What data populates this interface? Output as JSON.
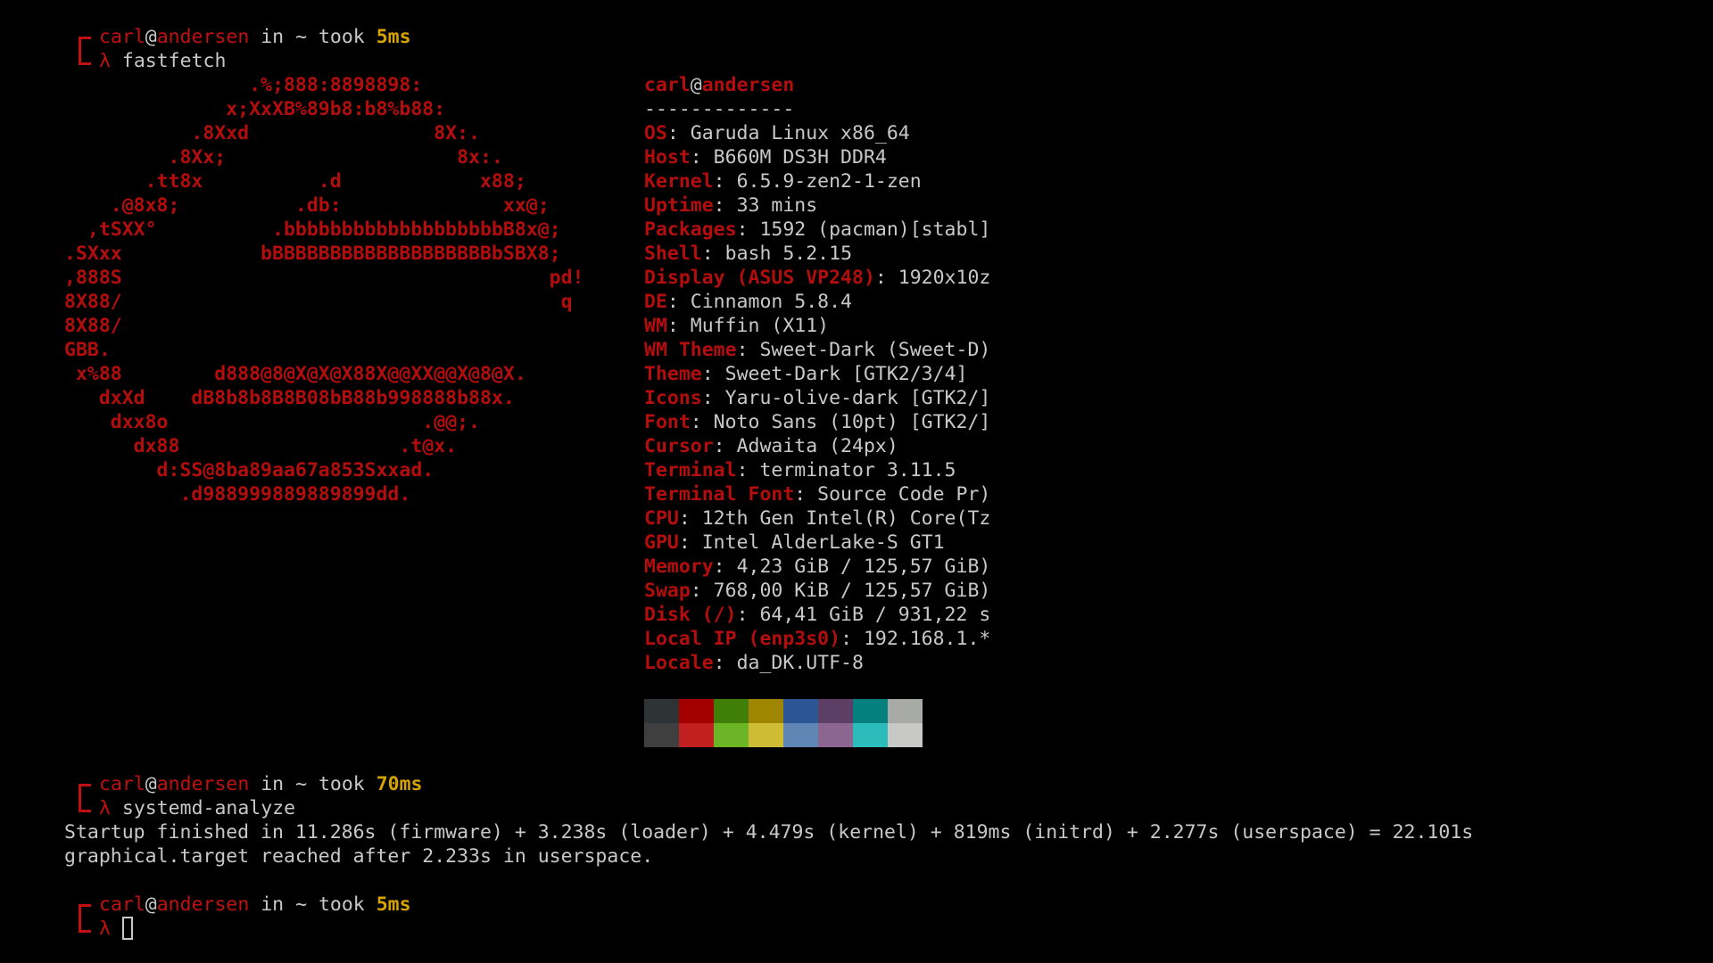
{
  "prompts": [
    {
      "user": "carl",
      "at": "@",
      "host": "andersen",
      "in": " in ~ took ",
      "time": "5ms",
      "symbol": "λ",
      "command": "fastfetch"
    },
    {
      "user": "carl",
      "at": "@",
      "host": "andersen",
      "in": " in ~ took ",
      "time": "70ms",
      "symbol": "λ",
      "command": "systemd-analyze"
    },
    {
      "user": "carl",
      "at": "@",
      "host": "andersen",
      "in": " in ~ took ",
      "time": "5ms",
      "symbol": "λ",
      "command": ""
    }
  ],
  "ascii_logo": "                .%;888:8898898:\n              x;XxXB%89b8:b8%b88:\n           .8Xxd                8X:.\n         .8Xx;                    8x:.\n       .tt8x          .d            x88;\n    .@8x8;          .db:              xx@;\n  ,tSXX°          .bbbbbbbbbbbbbbbbbbbB8x@;\n.SXxx            bBBBBBBBBBBBBBBBBBBBbSBX8;\n,888S                                     pd!\n8X88/                                      q\n8X88/\nGBB.\n x%88        d888@8@X@X@X88X@@XX@@X@8@X.\n   dxXd    dB8b8b8B8B08bB88b998888b88x.\n    dxx8o                      .@@;.\n      dx88                   .t@x.\n        d:SS@8ba89aa67a853Sxxad.\n          .d988999889889899dd.",
  "fastfetch": {
    "title_user": "carl",
    "title_at": "@",
    "title_host": "andersen",
    "separator": "-------------",
    "info": [
      {
        "key": "OS",
        "value": "Garuda Linux x86_64"
      },
      {
        "key": "Host",
        "value": "B660M DS3H DDR4"
      },
      {
        "key": "Kernel",
        "value": "6.5.9-zen2-1-zen"
      },
      {
        "key": "Uptime",
        "value": "33 mins"
      },
      {
        "key": "Packages",
        "value": "1592 (pacman)[stabl]"
      },
      {
        "key": "Shell",
        "value": "bash 5.2.15"
      },
      {
        "key": "Display (ASUS VP248)",
        "value": "1920x10z"
      },
      {
        "key": "DE",
        "value": "Cinnamon 5.8.4"
      },
      {
        "key": "WM",
        "value": "Muffin (X11)"
      },
      {
        "key": "WM Theme",
        "value": "Sweet-Dark (Sweet-D)"
      },
      {
        "key": "Theme",
        "value": "Sweet-Dark [GTK2/3/4]"
      },
      {
        "key": "Icons",
        "value": "Yaru-olive-dark [GTK2/]"
      },
      {
        "key": "Font",
        "value": "Noto Sans (10pt) [GTK2/]"
      },
      {
        "key": "Cursor",
        "value": "Adwaita (24px)"
      },
      {
        "key": "Terminal",
        "value": "terminator 3.11.5"
      },
      {
        "key": "Terminal Font",
        "value": "Source Code Pr)"
      },
      {
        "key": "CPU",
        "value": "12th Gen Intel(R) Core(Tz"
      },
      {
        "key": "GPU",
        "value": "Intel AlderLake-S GT1"
      },
      {
        "key": "Memory",
        "value": "4,23 GiB / 125,57 GiB)"
      },
      {
        "key": "Swap",
        "value": "768,00 KiB / 125,57 GiB)"
      },
      {
        "key": "Disk (/)",
        "value": "64,41 GiB / 931,22 s"
      },
      {
        "key": "Local IP (enp3s0)",
        "value": "192.168.1.*"
      },
      {
        "key": "Locale",
        "value": "da_DK.UTF-8"
      }
    ],
    "palette_top": [
      "#2e3436",
      "#a40000",
      "#3f7f07",
      "#9e8600",
      "#2c5596",
      "#5d3f66",
      "#067f7f",
      "#a8aaa6"
    ],
    "palette_bottom": [
      "#3f3f3f",
      "#c22020",
      "#6bb526",
      "#cebc35",
      "#5f86b4",
      "#8b6691",
      "#2cbcbc",
      "#c8c8c6"
    ]
  },
  "systemd_analyze": {
    "line1": "Startup finished in 11.286s (firmware) + 3.238s (loader) + 4.479s (kernel) + 819ms (initrd) + 2.277s (userspace) = 22.101s",
    "line2": "graphical.target reached after 2.233s in userspace."
  },
  "colors": {
    "background": "#000000",
    "text": "#c8c8c8",
    "accent_red": "#b30d0d",
    "time_yellow": "#d6a300"
  }
}
